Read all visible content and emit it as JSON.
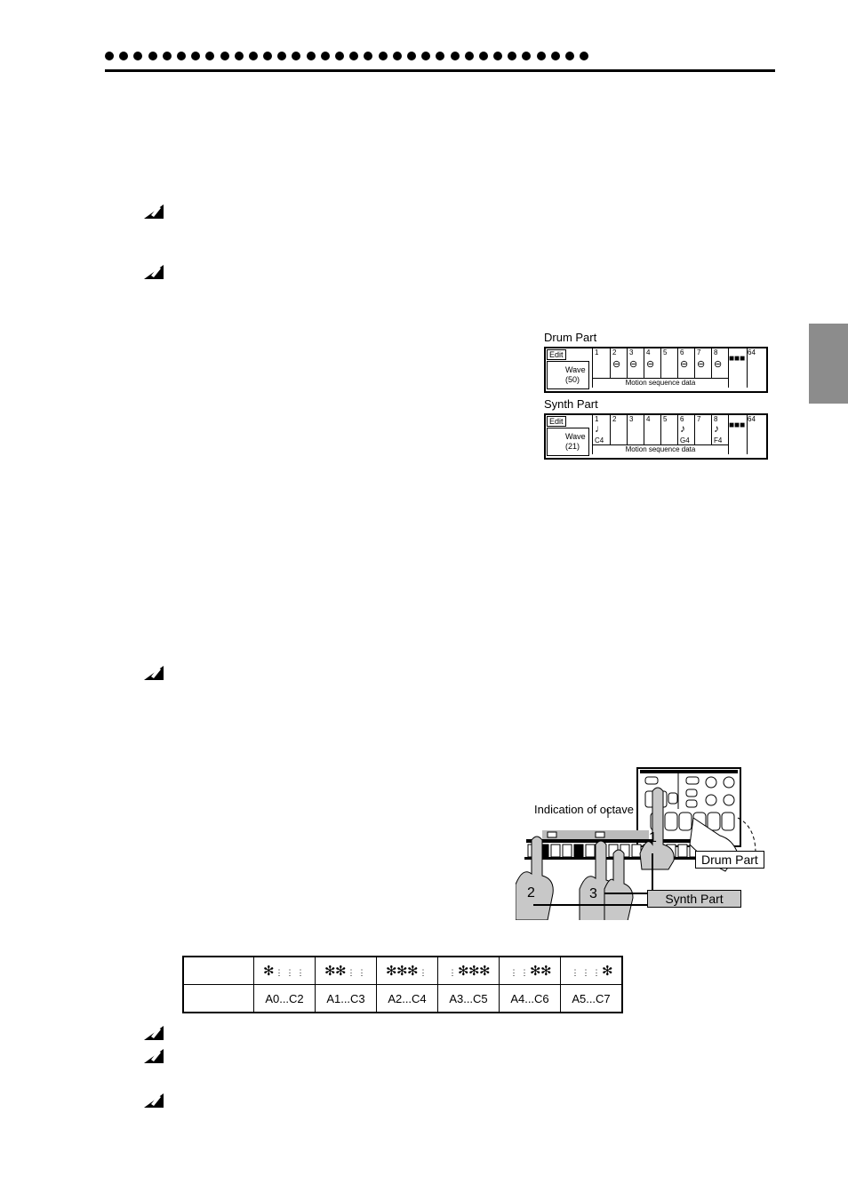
{
  "page": {
    "accent_tab_color": "#8c8c8c"
  },
  "notes": [
    {
      "icon": "note-pencil-icon"
    },
    {
      "icon": "note-pencil-icon"
    },
    {
      "icon": "note-pencil-icon"
    },
    {
      "icon": "note-pencil-icon"
    },
    {
      "icon": "note-pencil-icon"
    },
    {
      "icon": "note-pencil-icon"
    }
  ],
  "sequence_figure": {
    "drum": {
      "title": "Drum Part",
      "edit": "Edit",
      "wave": "Wave",
      "wave_num": "(50)",
      "steps": [
        "1",
        "2",
        "3",
        "4",
        "5",
        "6",
        "7",
        "8"
      ],
      "last_step": "64",
      "drum_steps": [
        false,
        true,
        true,
        true,
        false,
        true,
        true,
        true
      ],
      "motion": "Motion sequence data"
    },
    "synth": {
      "title": "Synth Part",
      "edit": "Edit",
      "wave": "Wave",
      "wave_num": "(21)",
      "steps": [
        "1",
        "2",
        "3",
        "4",
        "5",
        "6",
        "7",
        "8"
      ],
      "last_step": "64",
      "notes": [
        "C4",
        "",
        "",
        "",
        "",
        "G4",
        "",
        "F4"
      ],
      "motion": "Motion sequence data"
    }
  },
  "keyboard_figure": {
    "octave_label": "Indication of octave",
    "drum_label": "Drum Part",
    "synth_label": "Synth Part",
    "step_markers": [
      "1",
      "2",
      "3"
    ]
  },
  "octave_table": {
    "ranges": [
      "A0...C2",
      "A1...C3",
      "A2...C4",
      "A3...C5",
      "A4...C6",
      "A5...C7"
    ],
    "lit_patterns": [
      [
        1,
        0,
        0,
        0
      ],
      [
        1,
        1,
        0,
        0
      ],
      [
        1,
        1,
        1,
        0
      ],
      [
        0,
        1,
        1,
        1
      ],
      [
        0,
        0,
        1,
        1
      ],
      [
        0,
        0,
        0,
        1
      ]
    ]
  }
}
